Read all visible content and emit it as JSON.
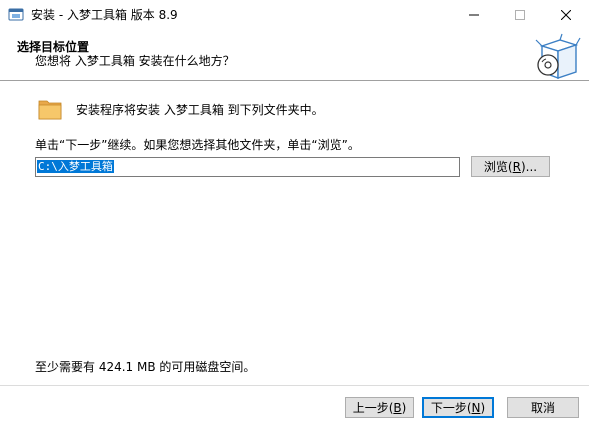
{
  "window": {
    "title": "安装 - 入梦工具箱 版本 8.9",
    "minimize_glyph": "—",
    "maximize_glyph": "☐",
    "close_glyph": "✕"
  },
  "header": {
    "title": "选择目标位置",
    "subtitle": "您想将 入梦工具箱 安装在什么地方？"
  },
  "body": {
    "info": "安装程序将安装 入梦工具箱 到下列文件夹中。",
    "instruction": "单击“下一步”继续。如果您想选择其他文件夹，单击“浏览”。",
    "path_value": "C:\\入梦工具箱",
    "browse_label_pre": "浏览(",
    "browse_hotkey": "R",
    "browse_label_post": ")...",
    "space_text": "至少需要有 424.1 MB 的可用磁盘空间。"
  },
  "footer": {
    "back_pre": "上一步(",
    "back_hotkey": "B",
    "back_post": ")",
    "next_pre": "下一步(",
    "next_hotkey": "N",
    "next_post": ")",
    "cancel_label": "取消"
  },
  "icons": {
    "app": "installer-app-icon",
    "setup": "setup-box-disc-icon",
    "folder": "folder-icon"
  }
}
